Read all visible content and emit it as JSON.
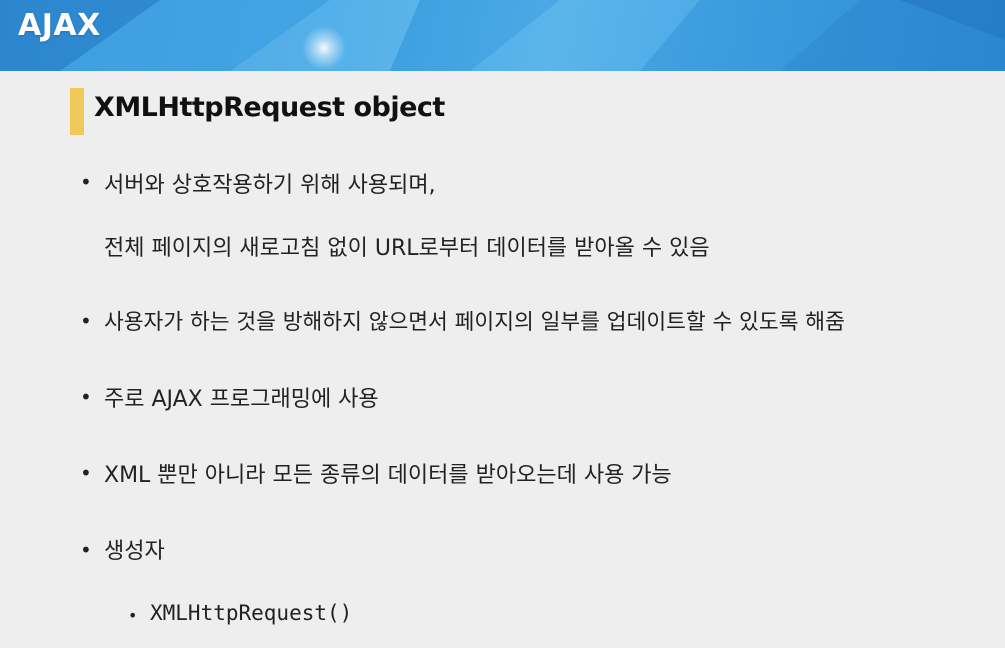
{
  "header": {
    "title": "AJAX"
  },
  "section": {
    "title": "XMLHttpRequest object"
  },
  "items": [
    {
      "line1": "서버와 상호작용하기 위해 사용되며,",
      "line2": "전체 페이지의 새로고침 없이 URL로부터 데이터를 받아올 수 있음"
    },
    {
      "text": "사용자가 하는 것을 방해하지 않으면서 페이지의 일부를 업데이트할 수 있도록 해줌"
    },
    {
      "text": "주로 AJAX 프로그래밍에 사용"
    },
    {
      "text": "XML 뿐만 아니라 모든 종류의 데이터를 받아오는데 사용 가능"
    },
    {
      "text": "생성자",
      "sub": [
        "XMLHttpRequest()"
      ]
    }
  ],
  "bullet_glyph": "•",
  "colors": {
    "header_blue": "#3aa0e2",
    "accent_bar": "#f1c85a",
    "background": "#eeeeee",
    "text": "#222222"
  }
}
